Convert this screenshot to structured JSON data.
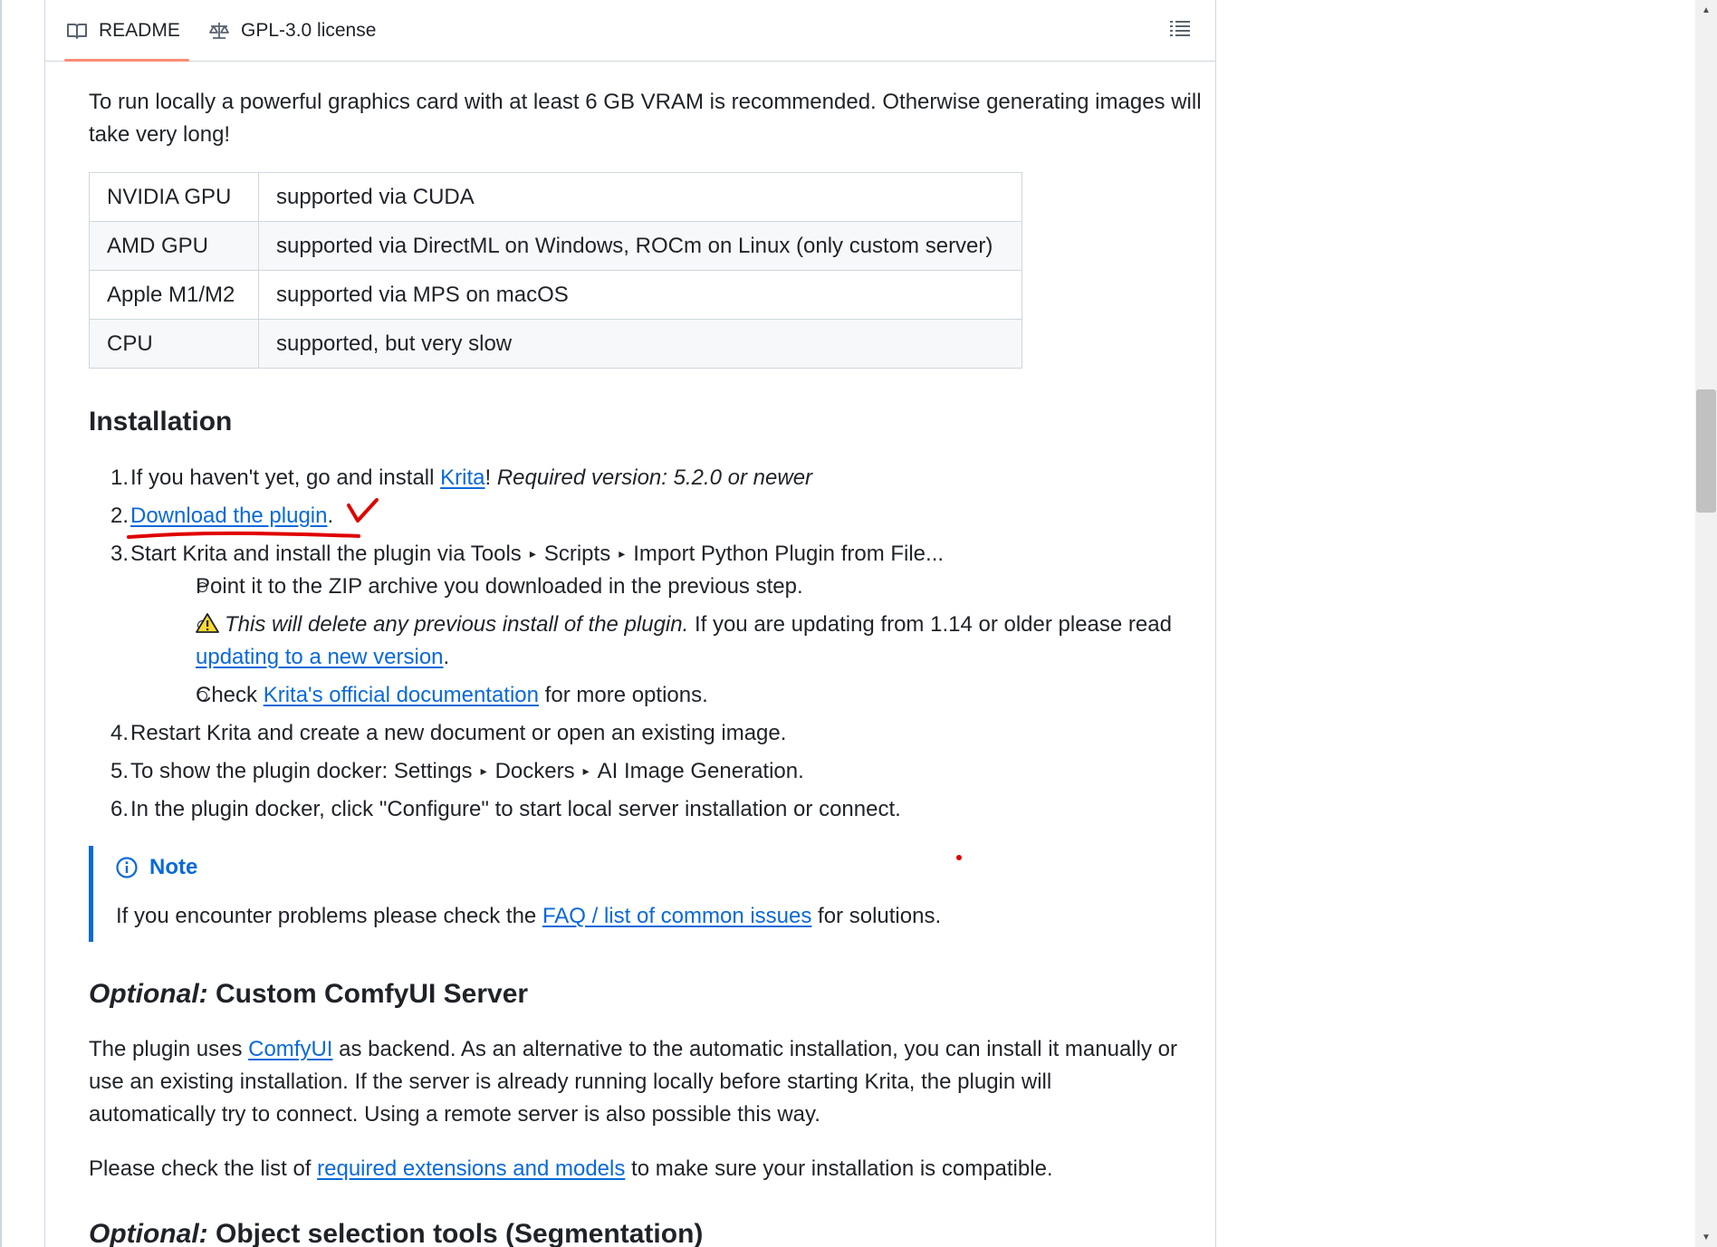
{
  "tabs": {
    "readme_label": "README",
    "license_label": "GPL-3.0 license",
    "toc_icon": "list-unordered-icon"
  },
  "hardware": {
    "intro": "To run locally a powerful graphics card with at least 6 GB VRAM is recommended. Otherwise generating images will take very long!",
    "rows": [
      {
        "device": "NVIDIA GPU",
        "support": "supported via CUDA"
      },
      {
        "device": "AMD GPU",
        "support": "supported via DirectML on Windows, ROCm on Linux (only custom server)"
      },
      {
        "device": "Apple M1/M2",
        "support": "supported via MPS on macOS"
      },
      {
        "device": "CPU",
        "support": "supported, but very slow"
      }
    ]
  },
  "installation": {
    "heading": "Installation",
    "step1_prefix": "If you haven't yet, go and install ",
    "step1_link": "Krita",
    "step1_bang": "!",
    "step1_required": "Required version: 5.2.0 or newer",
    "step2_link": "Download the plugin",
    "step2_suffix": ".",
    "step3_prefix": "Start Krita and install the plugin via Tools",
    "step3_mid": "Scripts",
    "step3_end": "Import Python Plugin from File...",
    "step3_sub1": "Point it to the ZIP archive you downloaded in the previous step.",
    "step3_sub2_italic": "This will delete any previous install of the plugin.",
    "step3_sub2_rest": " If you are updating from 1.14 or older please read",
    "step3_sub2_link": "updating to a new version",
    "step3_sub2_end": ".",
    "step3_sub3_prefix": "Check ",
    "step3_sub3_link": "Krita's official documentation",
    "step3_sub3_suffix": " for more options.",
    "step4": "Restart Krita and create a new document or open an existing image.",
    "step5_prefix": "To show the plugin docker: Settings",
    "step5_mid": "Dockers",
    "step5_end": "AI Image Generation.",
    "step6": "In the plugin docker, click \"Configure\" to start local server installation or connect.",
    "arrow_glyph": "▸",
    "warning_icon": "warning-icon"
  },
  "note": {
    "title": "Note",
    "icon": "info-icon",
    "text_prefix": "If you encounter problems please check the ",
    "text_link": "FAQ / list of common issues",
    "text_suffix": " for solutions."
  },
  "custom_server": {
    "heading_italic": "Optional:",
    "heading_rest": " Custom ComfyUI Server",
    "para1_prefix": "The plugin uses ",
    "para1_link": "ComfyUI",
    "para1_line1_rest": " as backend. As an alternative to the automatic installation, you can install it manually or",
    "para1_line2": "use an existing installation. If the server is already running locally before starting Krita, the plugin will",
    "para1_line3": "automatically try to connect. Using a remote server is also possible this way.",
    "para2_prefix": "Please check the list of ",
    "para2_link": "required extensions and models",
    "para2_suffix": " to make sure your installation is compatible."
  },
  "segmentation": {
    "heading_italic": "Optional:",
    "heading_rest": " Object selection tools (Segmentation)"
  },
  "colors": {
    "link": "#0969da",
    "text": "#1f2328",
    "border": "#d0d7de",
    "tab_underline": "#fd8c73",
    "annotation": "#e00000"
  }
}
